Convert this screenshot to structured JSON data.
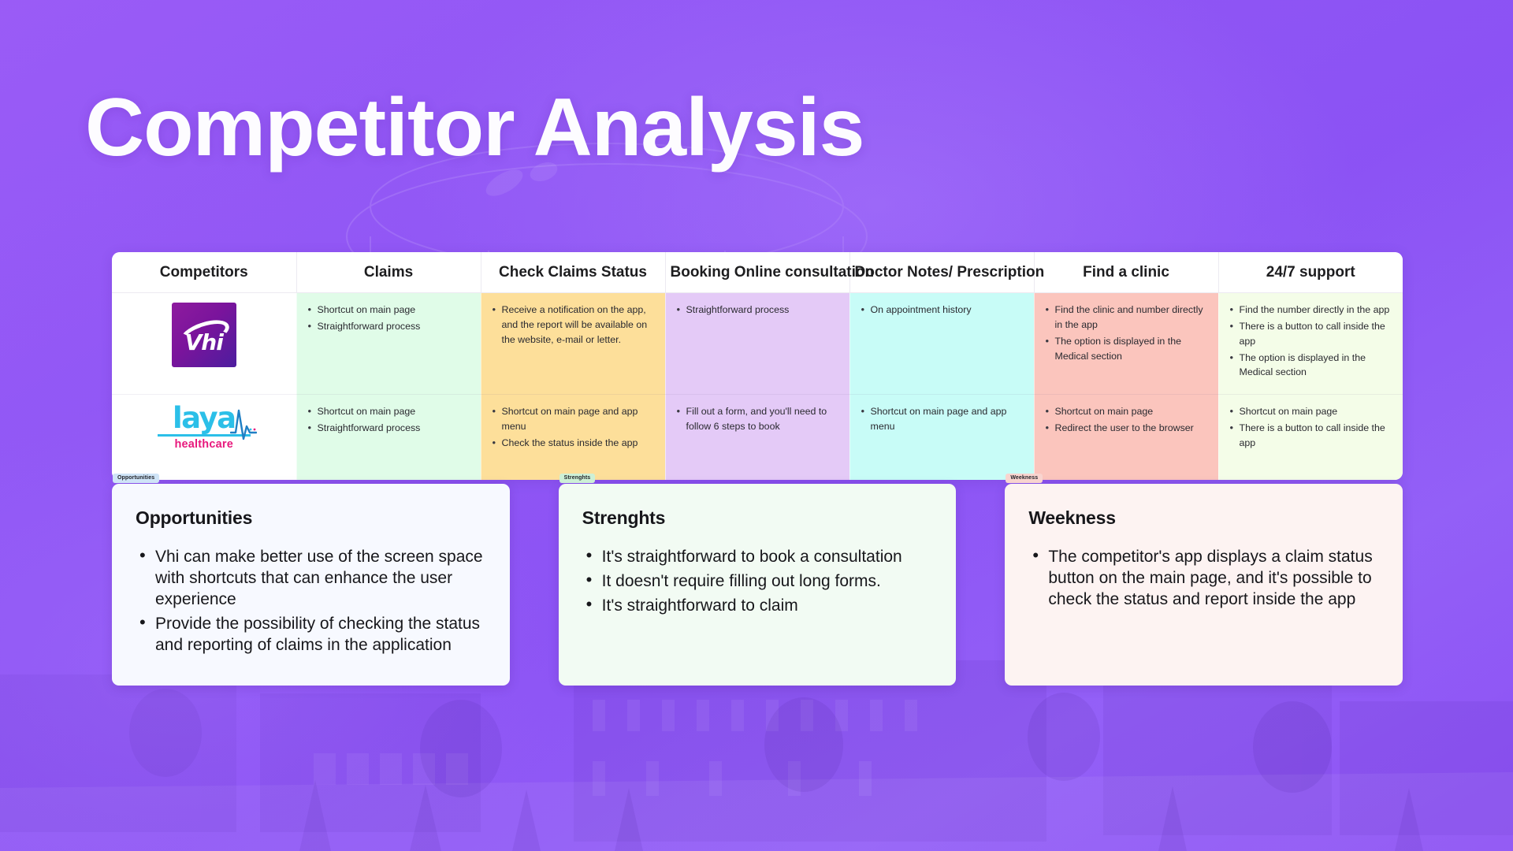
{
  "page": {
    "title": "Competitor Analysis",
    "background_accent": "#8b52f4"
  },
  "table": {
    "headers": [
      "Competitors",
      "Claims",
      "Check Claims Status",
      "Booking Online consultation",
      "Doctor Notes/ Prescription",
      "Find a clinic",
      "24/7 support"
    ],
    "column_colors": [
      "#ffffff",
      "#e0fce8",
      "#fddf9a",
      "#e4caf7",
      "#c8fcf7",
      "#fbc5bd",
      "#f4fde8"
    ],
    "rows": [
      {
        "competitor": "Vhi",
        "logo": "vhi-logo",
        "cells": [
          [
            "Shortcut on main page",
            "Straightforward process"
          ],
          [
            "Receive a notification on the app, and the report will be available on the website, e-mail or letter."
          ],
          [
            "Straightforward process"
          ],
          [
            "On appointment history"
          ],
          [
            "Find the clinic and number directly in the app",
            "The option is displayed in the Medical section"
          ],
          [
            "Find the number directly in the app",
            "There is a button to call inside the app",
            "The option is displayed in the Medical section"
          ]
        ]
      },
      {
        "competitor": "laya healthcare",
        "logo": "laya-logo",
        "logo_text": "laya",
        "logo_subtext": "healthcare",
        "cells": [
          [
            "Shortcut on main page",
            "Straightforward process"
          ],
          [
            "Shortcut on main page and app menu",
            "Check the status inside the app"
          ],
          [
            "Fill out a form, and you'll need to follow 6 steps to book"
          ],
          [
            "Shortcut on main page and app menu"
          ],
          [
            "Shortcut on main page",
            "Redirect the user to the browser"
          ],
          [
            "Shortcut on main page",
            "There is a button to call inside the app"
          ]
        ]
      }
    ]
  },
  "cards": [
    {
      "tab": "Opportunities",
      "tab_bg": "#cfe4f7",
      "bg": "#f7f9ff",
      "title": "Opportunities",
      "items": [
        "Vhi can make better use of the screen space with shortcuts that can enhance the user experience",
        "Provide the possibility of checking the status and reporting of claims in the application"
      ]
    },
    {
      "tab": "Strenghts",
      "tab_bg": "#cdf0d6",
      "bg": "#f2fbf3",
      "title": "Strenghts",
      "items": [
        "It's straightforward to book a consultation",
        "It doesn't require filling out long forms.",
        "It's straightforward to claim"
      ]
    },
    {
      "tab": "Weekness",
      "tab_bg": "#f8d4cf",
      "bg": "#fdf3f2",
      "title": "Weekness",
      "items": [
        "The competitor's app displays a claim status button on the main page, and it's possible to check the status and report inside the app"
      ]
    }
  ]
}
